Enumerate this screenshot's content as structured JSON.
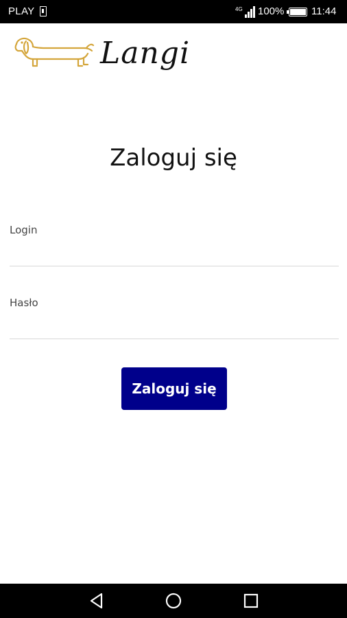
{
  "status_bar": {
    "carrier": "PLAY",
    "battery_percent": "100%",
    "time": "11:44",
    "icons": [
      "sim-icon",
      "signal-icon",
      "battery-icon"
    ]
  },
  "logo": {
    "wordmark": "Langi",
    "icon": "dachshund-icon",
    "icon_color": "#d4a53a"
  },
  "page": {
    "title": "Zaloguj się"
  },
  "form": {
    "login_label": "Login",
    "login_value": "",
    "password_label": "Hasło",
    "password_value": "",
    "submit_label": "Zaloguj się"
  },
  "nav_bar": {
    "icons": [
      "back-icon",
      "home-icon",
      "recents-icon"
    ]
  },
  "colors": {
    "button_bg": "#00008b",
    "button_text": "#ffffff",
    "divider": "#d7d7d7"
  }
}
